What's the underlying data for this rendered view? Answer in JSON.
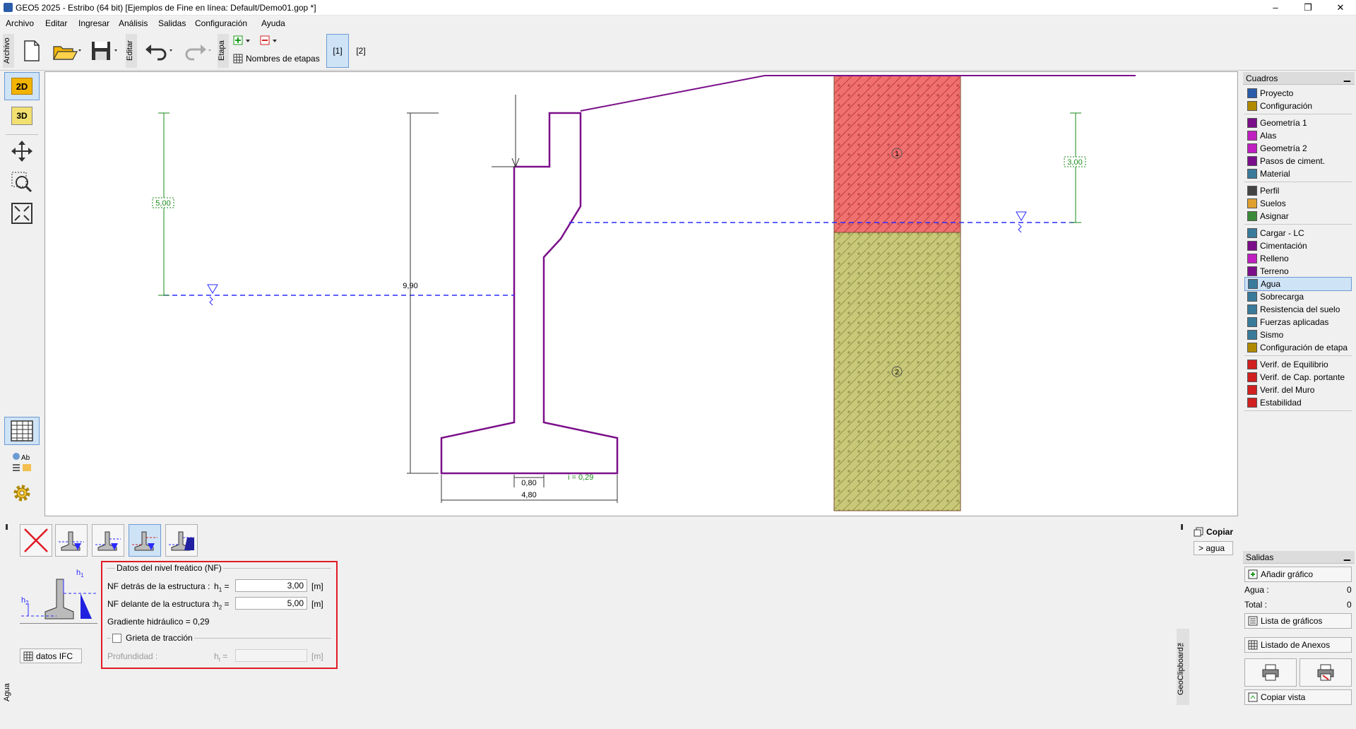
{
  "window": {
    "title": "GEO5 2025 - Estribo (64 bit) [Ejemplos de Fine en línea: Default/Demo01.gop *]",
    "minimize": "–",
    "maximize": "❐",
    "close": "✕"
  },
  "menu": [
    "Archivo",
    "Editar",
    "Ingresar",
    "Análisis",
    "Salidas",
    "Configuración",
    "Ayuda"
  ],
  "toolbar": {
    "archivo_label": "Archivo",
    "editar_label": "Editar",
    "etapa_label": "Etapa",
    "stage_names_label": "Nombres de etapas",
    "stages": [
      "[1]",
      "[2]"
    ],
    "active_stage": "[1]"
  },
  "left_tools": {
    "btn_2d": "2D",
    "btn_3d": "3D"
  },
  "drawing": {
    "dim_left": "5,00",
    "dim_height": "9,90",
    "dim_right": "3,00",
    "dim_toe": "0,80",
    "dim_base": "4,80",
    "gradient_note": "i = 0,29",
    "soil_1": "1",
    "soil_2": "2",
    "soil_1_color": "#f07070",
    "soil_2_color": "#c8c878",
    "wall_color": "#7b0f8a",
    "water_color": "#2b2bff",
    "dim_color": "#1a8a1a"
  },
  "right_panel": {
    "cuadros_title": "Cuadros",
    "groups": [
      [
        "Proyecto",
        "Configuración"
      ],
      [
        "Geometría 1",
        "Alas",
        "Geometría 2",
        "Pasos de ciment.",
        "Material"
      ],
      [
        "Perfil",
        "Suelos",
        "Asignar"
      ],
      [
        "Cargar - LC",
        "Cimentación",
        "Relleno",
        "Terreno",
        "Agua",
        "Sobrecarga",
        "Resistencia del suelo",
        "Fuerzas aplicadas",
        "Sismo",
        "Configuración de etapa"
      ],
      [
        "Verif. de Equilibrio",
        "Verif. de Cap. portante",
        "Verif. del Muro",
        "Estabilidad"
      ]
    ],
    "active_item": "Agua",
    "salidas_title": "Salidas",
    "add_graphic": "Añadir gráfico",
    "agua_label": "Agua :",
    "agua_count": "0",
    "total_label": "Total :",
    "total_count": "0",
    "graphics_list": "Lista de gráficos",
    "annex_list": "Listado de Anexos",
    "copy_view": "Copiar vista"
  },
  "bottom": {
    "tab_label": "Agua",
    "ifc_button": "datos IFC",
    "copy_label": "Copiar",
    "paste_label": "> agua",
    "geoclipboard": "GeoClipboard™",
    "form": {
      "group_title": "Datos del nivel freático (NF)",
      "behind_label": "NF detrás de la estructura :",
      "h1_symbol": "h",
      "h1_sub": "1",
      "h1_value": "3,00",
      "front_label": "NF delante de la estructura :",
      "h2_symbol": "h",
      "h2_sub": "2",
      "h2_value": "5,00",
      "unit": "[m]",
      "gradient_label": "Gradiente hidráulico = 0,29",
      "crack_title": "Grieta de tracción",
      "depth_label": "Profundidad :",
      "ht_symbol": "h",
      "ht_sub": "t",
      "ht_value": ""
    },
    "preview": {
      "h1": "h",
      "h1_sub": "1",
      "h2": "h",
      "h2_sub": "2"
    }
  }
}
